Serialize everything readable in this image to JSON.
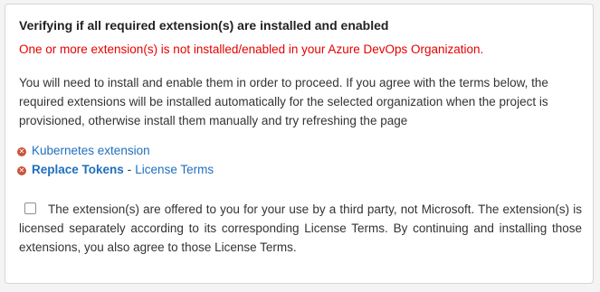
{
  "verify": {
    "title": "Verifying if all required extension(s) are installed and enabled",
    "error": "One or more extension(s) is not installed/enabled in your Azure DevOps Organization.",
    "description": "You will need to install and enable them in order to proceed. If you agree with the terms below, the required extensions will be installed automatically for the selected organization when the project is provisioned, otherwise install them manually and try refreshing the page",
    "extensions": [
      {
        "name": "Kubernetes extension",
        "status_icon": "error-x-icon"
      },
      {
        "name": "Replace Tokens",
        "separator": "-",
        "terms_link": "License Terms",
        "status_icon": "error-x-icon"
      }
    ],
    "agreement": {
      "checked": false,
      "text": "The extension(s) are offered to you for your use by a third party, not Microsoft. The extension(s) is licensed separately according to its corresponding License Terms. By continuing and installing those extensions, you also agree to those License Terms."
    },
    "colors": {
      "error": "#e60000",
      "link": "#1e6fbe",
      "icon": "#c9543f"
    }
  }
}
